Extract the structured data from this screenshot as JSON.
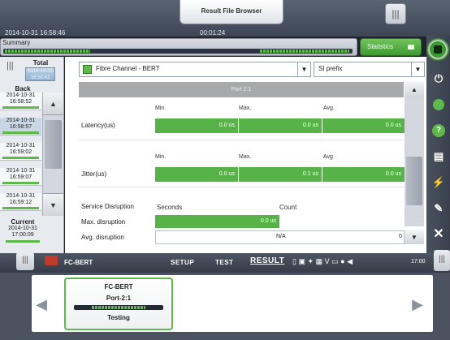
{
  "header": {
    "file_browser_tab": "Result File Browser",
    "datetime": "2014-10-31 16:58:46",
    "elapsed": "00:01:24",
    "summary_label": "Summary",
    "statistics_label": "Statistics"
  },
  "left_panel": {
    "total_label": "Total",
    "total_value": "2014-10-31 16:58:43",
    "back_label": "Back",
    "timestamps": [
      {
        "date": "2014-10-31",
        "time": "16:58:52",
        "selected": false
      },
      {
        "date": "2014-10-31",
        "time": "16:58:57",
        "selected": true
      },
      {
        "date": "2014-10-31",
        "time": "16:59:02",
        "selected": false
      },
      {
        "date": "2014-10-31",
        "time": "16:59:07",
        "selected": false
      },
      {
        "date": "2014-10-31",
        "time": "16:59:12",
        "selected": false
      }
    ],
    "current_label": "Current",
    "current_date": "2014-10-31",
    "current_time": "17:00:09"
  },
  "selectors": {
    "protocol": "Fibre Channel - BERT",
    "prefix": "SI prefix"
  },
  "table": {
    "header": "Port 2:1",
    "col_min": "Min.",
    "col_max": "Max.",
    "col_avg": "Avg.",
    "latency": {
      "label": "Latency(us)",
      "min": "0.0 us",
      "max": "0.0 us",
      "avg": "0.0 us"
    },
    "jitter": {
      "label": "Jitter(us)",
      "min": "0.0 us",
      "max": "0.1 us",
      "avg": "0.0 us"
    },
    "service_disruption": {
      "label": "Service Disruption",
      "col_seconds": "Seconds",
      "col_count": "Count"
    },
    "max_disruption": {
      "label": "Max. disruption",
      "seconds": "0.0 us"
    },
    "avg_disruption": {
      "label": "Avg. disruption",
      "seconds": "N/A",
      "count": "0"
    }
  },
  "bottom_nav": {
    "app_name": "FC-BERT",
    "setup": "SETUP",
    "test": "TEST",
    "result": "RESULT",
    "clock": "17:00"
  },
  "test_card": {
    "name": "FC-BERT",
    "port": "Port-2:1",
    "status": "Testing"
  },
  "colors": {
    "accent_green": "#57b347",
    "header_gray": "#a8a9ab"
  }
}
